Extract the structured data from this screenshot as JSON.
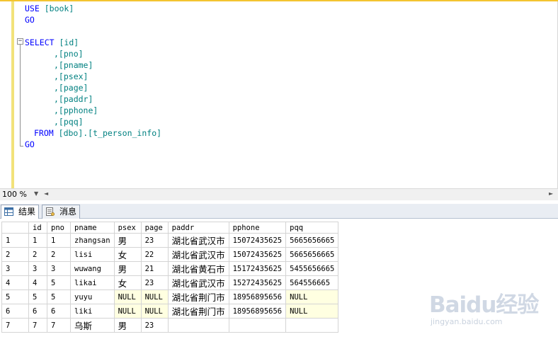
{
  "editor": {
    "lines": [
      {
        "kw": "USE",
        "rest": "[book]"
      },
      {
        "kw": "GO",
        "rest": ""
      },
      {
        "kw": "",
        "rest": ""
      },
      {
        "kw": "SELECT",
        "rest": "[id]"
      },
      {
        "kw": "",
        "rest": ",[pno]"
      },
      {
        "kw": "",
        "rest": ",[pname]"
      },
      {
        "kw": "",
        "rest": ",[psex]"
      },
      {
        "kw": "",
        "rest": ",[page]"
      },
      {
        "kw": "",
        "rest": ",[paddr]"
      },
      {
        "kw": "",
        "rest": ",[pphone]"
      },
      {
        "kw": "",
        "rest": ",[pqq]"
      },
      {
        "kw": "FROM",
        "rest": "[dbo].[t_person_info]"
      },
      {
        "kw": "GO",
        "rest": ""
      }
    ]
  },
  "zoom": {
    "value": "100 %"
  },
  "tabs": [
    {
      "label": "结果"
    },
    {
      "label": "消息"
    }
  ],
  "grid": {
    "columns": [
      "id",
      "pno",
      "pname",
      "psex",
      "page",
      "paddr",
      "pphone",
      "pqq"
    ],
    "rows": [
      {
        "num": "1",
        "cells": [
          "1",
          "1",
          "zhangsan",
          "男",
          "23",
          "湖北省武汉市",
          "15072435625",
          "5665656665"
        ]
      },
      {
        "num": "2",
        "cells": [
          "2",
          "2",
          "lisi",
          "女",
          "22",
          "湖北省武汉市",
          "15072435625",
          "5665656665"
        ]
      },
      {
        "num": "3",
        "cells": [
          "3",
          "3",
          "wuwang",
          "男",
          "21",
          "湖北省黄石市",
          "15172435625",
          "5455656665"
        ]
      },
      {
        "num": "4",
        "cells": [
          "4",
          "5",
          "likai",
          "女",
          "23",
          "湖北省武汉市",
          "15272435625",
          "564556665"
        ]
      },
      {
        "num": "5",
        "cells": [
          "5",
          "5",
          "yuyu",
          "NULL",
          "NULL",
          "湖北省荆门市",
          "18956895656",
          "NULL"
        ]
      },
      {
        "num": "6",
        "cells": [
          "6",
          "6",
          "liki",
          "NULL",
          "NULL",
          "湖北省荆门市",
          "18956895656",
          "NULL"
        ]
      },
      {
        "num": "7",
        "cells": [
          "7",
          "7",
          "乌斯",
          "男",
          "23",
          "",
          "",
          ""
        ]
      }
    ]
  },
  "watermark": {
    "logo": "Baidu经验",
    "url": "jingyan.baidu.com"
  },
  "colors": {
    "keyword": "#0000ff",
    "identifier": "#008080",
    "null_bg": "#ffffe1",
    "gutter": "#f2e27a"
  }
}
